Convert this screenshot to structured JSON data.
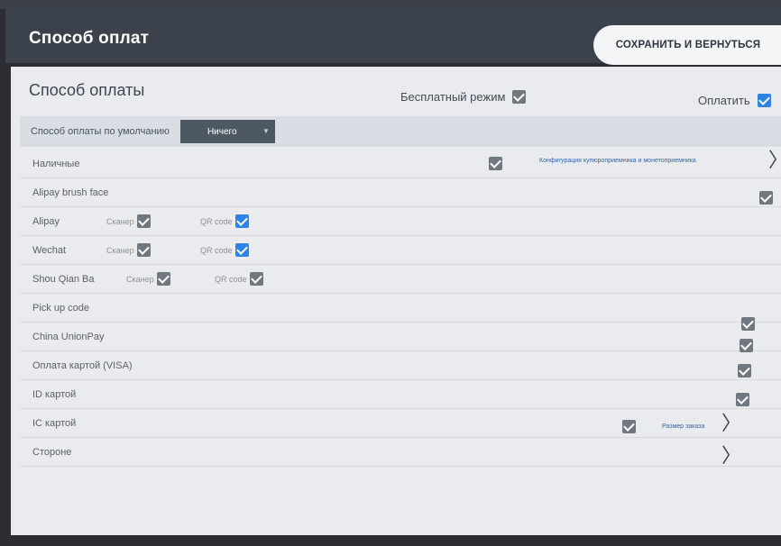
{
  "app_title": "Способ оплат",
  "save_button": "СОХРАНИТЬ И ВЕРНУТЬСЯ",
  "section_title": "Способ оплаты",
  "free_mode_label": "Бесплатный режим",
  "pay_label": "Оплатить",
  "default_payment": {
    "label": "Способ оплаты по умолчанию",
    "selected": "Ничего"
  },
  "config_link": "Конфигурация купюроприемника и монетоприемника",
  "order_link": "Размер заказа",
  "scanner_label": "Сканер",
  "qr_label": "QR code",
  "rows": [
    {
      "label": "Наличные"
    },
    {
      "label": "Alipay brush face"
    },
    {
      "label": "Alipay"
    },
    {
      "label": "Wechat"
    },
    {
      "label": "Shou Qian Ba"
    },
    {
      "label": "Pick up code"
    },
    {
      "label": "China UnionPay"
    },
    {
      "label": "Оплата картой (VISA)"
    },
    {
      "label": "ID картой"
    },
    {
      "label": "IC картой"
    },
    {
      "label": "Стороне"
    }
  ],
  "colors": {
    "header": "#3b424b",
    "panel": "#e9ebee",
    "checkbox_blue": "#2e83e6",
    "checkbox_gray": "#6f7780"
  }
}
